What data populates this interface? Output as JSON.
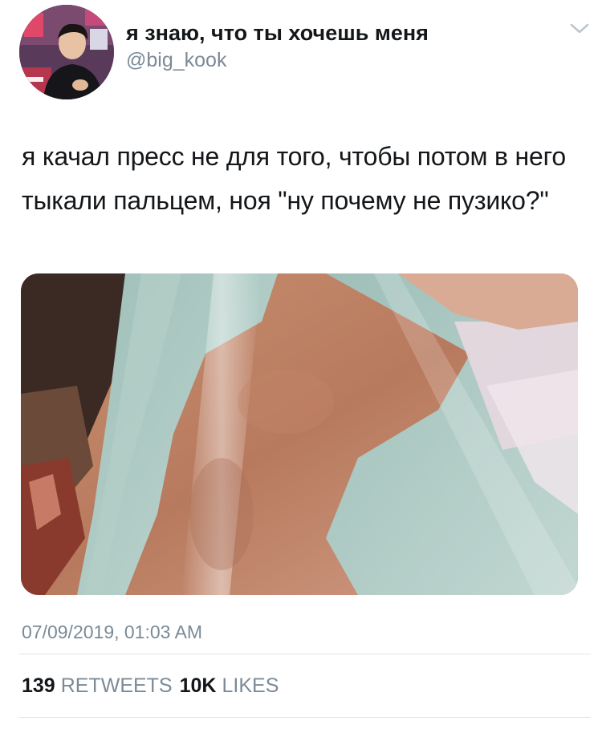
{
  "tweet": {
    "author": {
      "display_name": "я знаю, что ты хочешь меня",
      "handle": "@big_kook",
      "avatar_icon": "profile-photo"
    },
    "more_icon": "chevron-down-icon",
    "text": "я качал пресс не для того, чтобы потом в него тыкали пальцем, ноя \"ну почему не пузико?\"",
    "media_icon": "photo",
    "timestamp": "07/09/2019, 01:03 AM",
    "stats": {
      "retweets_count": "139",
      "retweets_label": "RETWEETS",
      "likes_count": "10K",
      "likes_label": "LIKES"
    }
  },
  "colors": {
    "text_primary": "#14171a",
    "text_secondary": "#7b8a97",
    "divider": "#dfe5ea",
    "background": "#ffffff"
  }
}
